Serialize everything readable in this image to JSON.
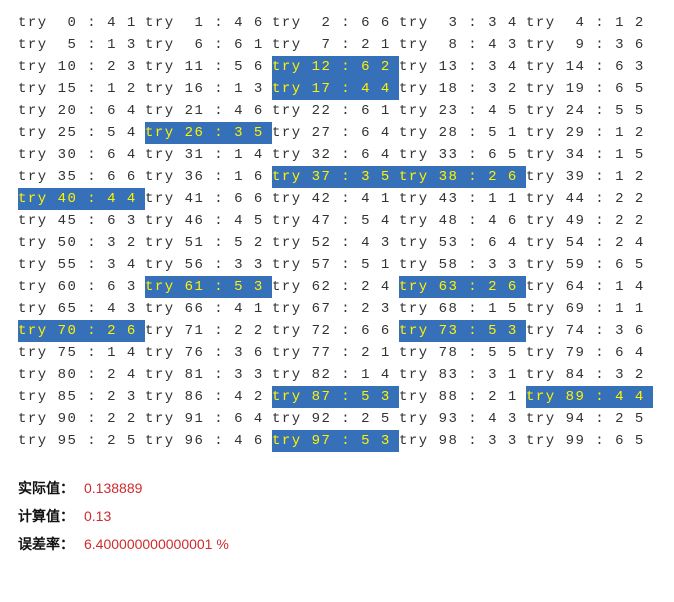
{
  "tries": [
    {
      "i": 0,
      "a": 4,
      "b": 1,
      "hl": false
    },
    {
      "i": 1,
      "a": 4,
      "b": 6,
      "hl": false
    },
    {
      "i": 2,
      "a": 6,
      "b": 6,
      "hl": false
    },
    {
      "i": 3,
      "a": 3,
      "b": 4,
      "hl": false
    },
    {
      "i": 4,
      "a": 1,
      "b": 2,
      "hl": false
    },
    {
      "i": 5,
      "a": 1,
      "b": 3,
      "hl": false
    },
    {
      "i": 6,
      "a": 6,
      "b": 1,
      "hl": false
    },
    {
      "i": 7,
      "a": 2,
      "b": 1,
      "hl": false
    },
    {
      "i": 8,
      "a": 4,
      "b": 3,
      "hl": false
    },
    {
      "i": 9,
      "a": 3,
      "b": 6,
      "hl": false
    },
    {
      "i": 10,
      "a": 2,
      "b": 3,
      "hl": false
    },
    {
      "i": 11,
      "a": 5,
      "b": 6,
      "hl": false
    },
    {
      "i": 12,
      "a": 6,
      "b": 2,
      "hl": true
    },
    {
      "i": 13,
      "a": 3,
      "b": 4,
      "hl": false
    },
    {
      "i": 14,
      "a": 6,
      "b": 3,
      "hl": false
    },
    {
      "i": 15,
      "a": 1,
      "b": 2,
      "hl": false
    },
    {
      "i": 16,
      "a": 1,
      "b": 3,
      "hl": false
    },
    {
      "i": 17,
      "a": 4,
      "b": 4,
      "hl": true
    },
    {
      "i": 18,
      "a": 3,
      "b": 2,
      "hl": false
    },
    {
      "i": 19,
      "a": 6,
      "b": 5,
      "hl": false
    },
    {
      "i": 20,
      "a": 6,
      "b": 4,
      "hl": false
    },
    {
      "i": 21,
      "a": 4,
      "b": 6,
      "hl": false
    },
    {
      "i": 22,
      "a": 6,
      "b": 1,
      "hl": false
    },
    {
      "i": 23,
      "a": 4,
      "b": 5,
      "hl": false
    },
    {
      "i": 24,
      "a": 5,
      "b": 5,
      "hl": false
    },
    {
      "i": 25,
      "a": 5,
      "b": 4,
      "hl": false
    },
    {
      "i": 26,
      "a": 3,
      "b": 5,
      "hl": true
    },
    {
      "i": 27,
      "a": 6,
      "b": 4,
      "hl": false
    },
    {
      "i": 28,
      "a": 5,
      "b": 1,
      "hl": false
    },
    {
      "i": 29,
      "a": 1,
      "b": 2,
      "hl": false
    },
    {
      "i": 30,
      "a": 6,
      "b": 4,
      "hl": false
    },
    {
      "i": 31,
      "a": 1,
      "b": 4,
      "hl": false
    },
    {
      "i": 32,
      "a": 6,
      "b": 4,
      "hl": false
    },
    {
      "i": 33,
      "a": 6,
      "b": 5,
      "hl": false
    },
    {
      "i": 34,
      "a": 1,
      "b": 5,
      "hl": false
    },
    {
      "i": 35,
      "a": 6,
      "b": 6,
      "hl": false
    },
    {
      "i": 36,
      "a": 1,
      "b": 6,
      "hl": false
    },
    {
      "i": 37,
      "a": 3,
      "b": 5,
      "hl": true
    },
    {
      "i": 38,
      "a": 2,
      "b": 6,
      "hl": true
    },
    {
      "i": 39,
      "a": 1,
      "b": 2,
      "hl": false
    },
    {
      "i": 40,
      "a": 4,
      "b": 4,
      "hl": true
    },
    {
      "i": 41,
      "a": 6,
      "b": 6,
      "hl": false
    },
    {
      "i": 42,
      "a": 4,
      "b": 1,
      "hl": false
    },
    {
      "i": 43,
      "a": 1,
      "b": 1,
      "hl": false
    },
    {
      "i": 44,
      "a": 2,
      "b": 2,
      "hl": false
    },
    {
      "i": 45,
      "a": 6,
      "b": 3,
      "hl": false
    },
    {
      "i": 46,
      "a": 4,
      "b": 5,
      "hl": false
    },
    {
      "i": 47,
      "a": 5,
      "b": 4,
      "hl": false
    },
    {
      "i": 48,
      "a": 4,
      "b": 6,
      "hl": false
    },
    {
      "i": 49,
      "a": 2,
      "b": 2,
      "hl": false
    },
    {
      "i": 50,
      "a": 3,
      "b": 2,
      "hl": false
    },
    {
      "i": 51,
      "a": 5,
      "b": 2,
      "hl": false
    },
    {
      "i": 52,
      "a": 4,
      "b": 3,
      "hl": false
    },
    {
      "i": 53,
      "a": 6,
      "b": 4,
      "hl": false
    },
    {
      "i": 54,
      "a": 2,
      "b": 4,
      "hl": false
    },
    {
      "i": 55,
      "a": 3,
      "b": 4,
      "hl": false
    },
    {
      "i": 56,
      "a": 3,
      "b": 3,
      "hl": false
    },
    {
      "i": 57,
      "a": 5,
      "b": 1,
      "hl": false
    },
    {
      "i": 58,
      "a": 3,
      "b": 3,
      "hl": false
    },
    {
      "i": 59,
      "a": 6,
      "b": 5,
      "hl": false
    },
    {
      "i": 60,
      "a": 6,
      "b": 3,
      "hl": false
    },
    {
      "i": 61,
      "a": 5,
      "b": 3,
      "hl": true
    },
    {
      "i": 62,
      "a": 2,
      "b": 4,
      "hl": false
    },
    {
      "i": 63,
      "a": 2,
      "b": 6,
      "hl": true
    },
    {
      "i": 64,
      "a": 1,
      "b": 4,
      "hl": false
    },
    {
      "i": 65,
      "a": 4,
      "b": 3,
      "hl": false
    },
    {
      "i": 66,
      "a": 4,
      "b": 1,
      "hl": false
    },
    {
      "i": 67,
      "a": 2,
      "b": 3,
      "hl": false
    },
    {
      "i": 68,
      "a": 1,
      "b": 5,
      "hl": false
    },
    {
      "i": 69,
      "a": 1,
      "b": 1,
      "hl": false
    },
    {
      "i": 70,
      "a": 2,
      "b": 6,
      "hl": true
    },
    {
      "i": 71,
      "a": 2,
      "b": 2,
      "hl": false
    },
    {
      "i": 72,
      "a": 6,
      "b": 6,
      "hl": false
    },
    {
      "i": 73,
      "a": 5,
      "b": 3,
      "hl": true
    },
    {
      "i": 74,
      "a": 3,
      "b": 6,
      "hl": false
    },
    {
      "i": 75,
      "a": 1,
      "b": 4,
      "hl": false
    },
    {
      "i": 76,
      "a": 3,
      "b": 6,
      "hl": false
    },
    {
      "i": 77,
      "a": 2,
      "b": 1,
      "hl": false
    },
    {
      "i": 78,
      "a": 5,
      "b": 5,
      "hl": false
    },
    {
      "i": 79,
      "a": 6,
      "b": 4,
      "hl": false
    },
    {
      "i": 80,
      "a": 2,
      "b": 4,
      "hl": false
    },
    {
      "i": 81,
      "a": 3,
      "b": 3,
      "hl": false
    },
    {
      "i": 82,
      "a": 1,
      "b": 4,
      "hl": false
    },
    {
      "i": 83,
      "a": 3,
      "b": 1,
      "hl": false
    },
    {
      "i": 84,
      "a": 3,
      "b": 2,
      "hl": false
    },
    {
      "i": 85,
      "a": 2,
      "b": 3,
      "hl": false
    },
    {
      "i": 86,
      "a": 4,
      "b": 2,
      "hl": false
    },
    {
      "i": 87,
      "a": 5,
      "b": 3,
      "hl": true
    },
    {
      "i": 88,
      "a": 2,
      "b": 1,
      "hl": false
    },
    {
      "i": 89,
      "a": 4,
      "b": 4,
      "hl": true
    },
    {
      "i": 90,
      "a": 2,
      "b": 2,
      "hl": false
    },
    {
      "i": 91,
      "a": 6,
      "b": 4,
      "hl": false
    },
    {
      "i": 92,
      "a": 2,
      "b": 5,
      "hl": false
    },
    {
      "i": 93,
      "a": 4,
      "b": 3,
      "hl": false
    },
    {
      "i": 94,
      "a": 2,
      "b": 5,
      "hl": false
    },
    {
      "i": 95,
      "a": 2,
      "b": 5,
      "hl": false
    },
    {
      "i": 96,
      "a": 4,
      "b": 6,
      "hl": false
    },
    {
      "i": 97,
      "a": 5,
      "b": 3,
      "hl": true
    },
    {
      "i": 98,
      "a": 3,
      "b": 3,
      "hl": false
    },
    {
      "i": 99,
      "a": 6,
      "b": 5,
      "hl": false
    }
  ],
  "stats": {
    "actual_label": "实际值：",
    "actual_value": "0.138889",
    "calc_label": "计算值：",
    "calc_value": "0.13",
    "error_label": "误差率：",
    "error_value": "6.400000000000001 %"
  }
}
